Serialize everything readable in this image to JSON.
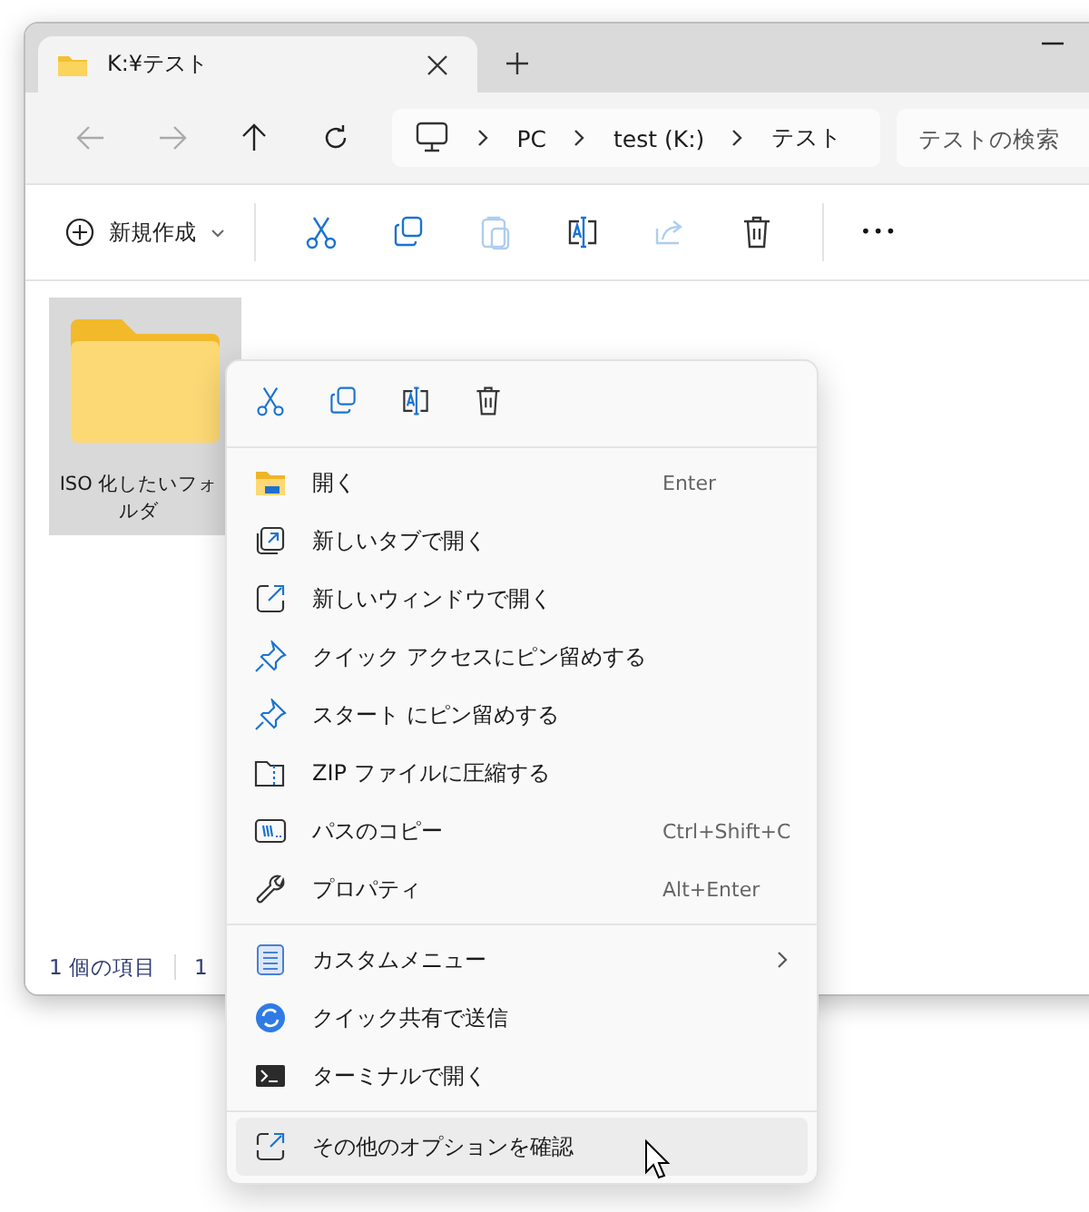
{
  "tabs": [
    {
      "title": "K:¥テスト",
      "selected": true
    }
  ],
  "nav": [
    {
      "disabled": true
    },
    {
      "disabled": true
    },
    {
      "disabled": false
    },
    {
      "disabled": false
    }
  ],
  "breadcrumb": [
    "PC",
    "test (K:)",
    "テスト"
  ],
  "search": {
    "placeholder": "テストの検索"
  },
  "toolbar": {
    "new_label": "新規作成",
    "actions": [
      {
        "kind": "cut",
        "disabled": false
      },
      {
        "kind": "copy",
        "disabled": false
      },
      {
        "kind": "paste",
        "disabled": true
      },
      {
        "kind": "rename",
        "disabled": false
      },
      {
        "kind": "share",
        "disabled": true
      },
      {
        "kind": "delete",
        "disabled": false
      }
    ],
    "more": "•••"
  },
  "files": [
    {
      "name": "ISO 化したいフォルダ",
      "selected": true
    }
  ],
  "status_bar": [
    "1 個の項目",
    "1"
  ],
  "context_menu": {
    "quick_actions": [
      {
        "kind": "cut"
      },
      {
        "kind": "copy"
      },
      {
        "kind": "rename"
      },
      {
        "kind": "delete"
      }
    ],
    "sections": [
      [
        {
          "kind": "open",
          "label": "開く",
          "shortcut": "Enter",
          "selected": false
        },
        {
          "kind": "newtab",
          "label": "新しいタブで開く",
          "selected": false
        },
        {
          "kind": "newwindow",
          "label": "新しいウィンドウで開く",
          "selected": false
        },
        {
          "kind": "pin",
          "label": "クイック アクセスにピン留めする",
          "selected": false
        },
        {
          "kind": "pin",
          "label": "スタート にピン留めする",
          "selected": false
        },
        {
          "kind": "zip",
          "label": "ZIP ファイルに圧縮する",
          "selected": false
        },
        {
          "kind": "path",
          "label": "パスのコピー",
          "shortcut": "Ctrl+Shift+C",
          "selected": false
        },
        {
          "kind": "wrench",
          "label": "プロパティ",
          "shortcut": "Alt+Enter",
          "selected": false
        }
      ],
      [
        {
          "kind": "custom",
          "label": "カスタムメニュー",
          "submenu": true,
          "selected": false
        },
        {
          "kind": "nearby",
          "label": "クイック共有で送信",
          "selected": false
        },
        {
          "kind": "terminal",
          "label": "ターミナルで開く",
          "selected": false
        }
      ],
      [
        {
          "kind": "more",
          "label": "その他のオプションを確認",
          "selected": true
        }
      ]
    ]
  }
}
